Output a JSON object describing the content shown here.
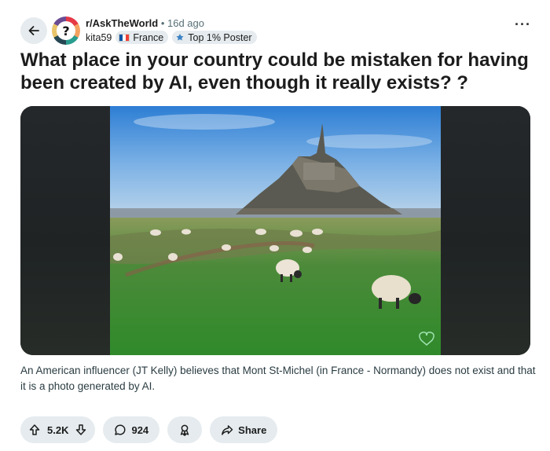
{
  "post": {
    "subreddit": "r/AskTheWorld",
    "time": "• 16d ago",
    "author": "kita59",
    "flair_country": "France",
    "flair_badge": "Top 1% Poster",
    "title": "What place in your country could be mistaken for having been created by AI, even though it really exists? ?",
    "caption": "An American influencer (JT Kelly) believes that Mont St-Michel (in France - Normandy) does not exist and that it is a photo generated by AI."
  },
  "actions": {
    "votes": "5.2K",
    "comments": "924",
    "share_label": "Share"
  },
  "icons": {
    "back": "arrow-left-icon",
    "more": "more-horizontal-icon",
    "upvote": "arrow-up-icon",
    "downvote": "arrow-down-icon",
    "comment": "comment-bubble-icon",
    "award": "award-icon",
    "share": "share-arrow-icon",
    "badge": "top-poster-badge-icon"
  },
  "colors": {
    "pill_bg": "#e5ebee",
    "flag_blue": "#0055a4",
    "flag_white": "#ffffff",
    "flag_red": "#ef4135",
    "meta_gray": "#576f76"
  }
}
